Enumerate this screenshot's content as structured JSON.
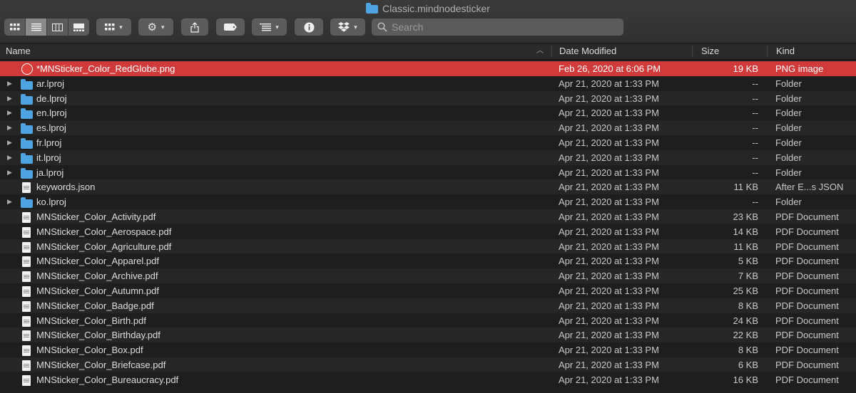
{
  "window": {
    "title": "Classic.mindnodesticker"
  },
  "toolbar": {
    "view_modes": [
      "icon-view-icon",
      "list-view-icon",
      "column-view-icon",
      "gallery-view-icon"
    ],
    "search_placeholder": "Search"
  },
  "columns": {
    "name": "Name",
    "date": "Date Modified",
    "size": "Size",
    "kind": "Kind"
  },
  "files": [
    {
      "name": "*MNSticker_Color_RedGlobe.png",
      "date": "Feb 26, 2020 at 6:06 PM",
      "size": "19 KB",
      "kind": "PNG image",
      "type": "png",
      "expandable": false,
      "selected": true
    },
    {
      "name": "ar.lproj",
      "date": "Apr 21, 2020 at 1:33 PM",
      "size": "--",
      "kind": "Folder",
      "type": "folder",
      "expandable": true
    },
    {
      "name": "de.lproj",
      "date": "Apr 21, 2020 at 1:33 PM",
      "size": "--",
      "kind": "Folder",
      "type": "folder",
      "expandable": true
    },
    {
      "name": "en.lproj",
      "date": "Apr 21, 2020 at 1:33 PM",
      "size": "--",
      "kind": "Folder",
      "type": "folder",
      "expandable": true
    },
    {
      "name": "es.lproj",
      "date": "Apr 21, 2020 at 1:33 PM",
      "size": "--",
      "kind": "Folder",
      "type": "folder",
      "expandable": true
    },
    {
      "name": "fr.lproj",
      "date": "Apr 21, 2020 at 1:33 PM",
      "size": "--",
      "kind": "Folder",
      "type": "folder",
      "expandable": true
    },
    {
      "name": "it.lproj",
      "date": "Apr 21, 2020 at 1:33 PM",
      "size": "--",
      "kind": "Folder",
      "type": "folder",
      "expandable": true
    },
    {
      "name": "ja.lproj",
      "date": "Apr 21, 2020 at 1:33 PM",
      "size": "--",
      "kind": "Folder",
      "type": "folder",
      "expandable": true
    },
    {
      "name": "keywords.json",
      "date": "Apr 21, 2020 at 1:33 PM",
      "size": "11 KB",
      "kind": "After E...s JSON",
      "type": "doc",
      "expandable": false
    },
    {
      "name": "ko.lproj",
      "date": "Apr 21, 2020 at 1:33 PM",
      "size": "--",
      "kind": "Folder",
      "type": "folder",
      "expandable": true
    },
    {
      "name": "MNSticker_Color_Activity.pdf",
      "date": "Apr 21, 2020 at 1:33 PM",
      "size": "23 KB",
      "kind": "PDF Document",
      "type": "doc",
      "expandable": false
    },
    {
      "name": "MNSticker_Color_Aerospace.pdf",
      "date": "Apr 21, 2020 at 1:33 PM",
      "size": "14 KB",
      "kind": "PDF Document",
      "type": "doc",
      "expandable": false
    },
    {
      "name": "MNSticker_Color_Agriculture.pdf",
      "date": "Apr 21, 2020 at 1:33 PM",
      "size": "11 KB",
      "kind": "PDF Document",
      "type": "doc",
      "expandable": false
    },
    {
      "name": "MNSticker_Color_Apparel.pdf",
      "date": "Apr 21, 2020 at 1:33 PM",
      "size": "5 KB",
      "kind": "PDF Document",
      "type": "doc",
      "expandable": false
    },
    {
      "name": "MNSticker_Color_Archive.pdf",
      "date": "Apr 21, 2020 at 1:33 PM",
      "size": "7 KB",
      "kind": "PDF Document",
      "type": "doc",
      "expandable": false
    },
    {
      "name": "MNSticker_Color_Autumn.pdf",
      "date": "Apr 21, 2020 at 1:33 PM",
      "size": "25 KB",
      "kind": "PDF Document",
      "type": "doc",
      "expandable": false
    },
    {
      "name": "MNSticker_Color_Badge.pdf",
      "date": "Apr 21, 2020 at 1:33 PM",
      "size": "8 KB",
      "kind": "PDF Document",
      "type": "doc",
      "expandable": false
    },
    {
      "name": "MNSticker_Color_Birth.pdf",
      "date": "Apr 21, 2020 at 1:33 PM",
      "size": "24 KB",
      "kind": "PDF Document",
      "type": "doc",
      "expandable": false
    },
    {
      "name": "MNSticker_Color_Birthday.pdf",
      "date": "Apr 21, 2020 at 1:33 PM",
      "size": "22 KB",
      "kind": "PDF Document",
      "type": "doc",
      "expandable": false
    },
    {
      "name": "MNSticker_Color_Box.pdf",
      "date": "Apr 21, 2020 at 1:33 PM",
      "size": "8 KB",
      "kind": "PDF Document",
      "type": "doc",
      "expandable": false
    },
    {
      "name": "MNSticker_Color_Briefcase.pdf",
      "date": "Apr 21, 2020 at 1:33 PM",
      "size": "6 KB",
      "kind": "PDF Document",
      "type": "doc",
      "expandable": false
    },
    {
      "name": "MNSticker_Color_Bureaucracy.pdf",
      "date": "Apr 21, 2020 at 1:33 PM",
      "size": "16 KB",
      "kind": "PDF Document",
      "type": "doc",
      "expandable": false
    }
  ],
  "colors": {
    "selection": "#d13a3a",
    "folder": "#4fa3e0",
    "background": "#1e1e1e",
    "alt_row": "#262626"
  }
}
